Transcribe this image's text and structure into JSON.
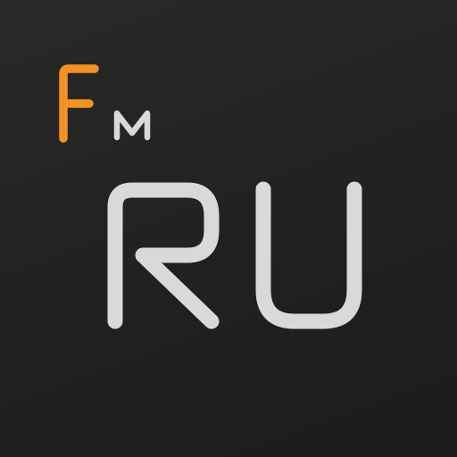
{
  "logo": {
    "brand_text": "FM",
    "main_text": "RU",
    "colors": {
      "background": "#232221",
      "accent": "#F39323",
      "letters": "#D9D9D9"
    }
  }
}
